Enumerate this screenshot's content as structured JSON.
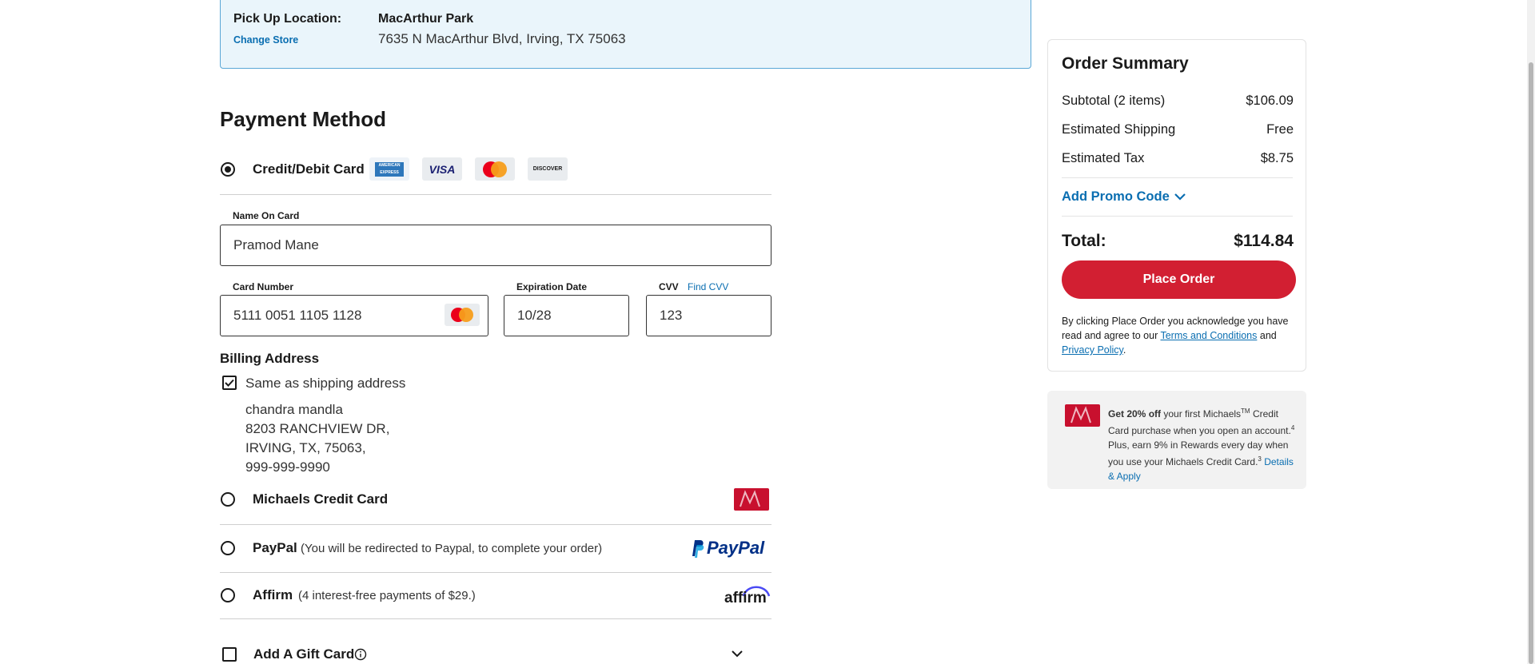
{
  "pickup": {
    "label": "Pick Up Location:",
    "change_link": "Change Store",
    "store_name": "MacArthur Park",
    "store_address": "7635 N MacArthur Blvd, Irving, TX 75063"
  },
  "payment": {
    "title": "Payment Method",
    "credit_option": {
      "label": "Credit/Debit Card",
      "selected": true,
      "card_brands": [
        "AMERICAN EXPRESS",
        "VISA",
        "MasterCard",
        "DISCOVER"
      ]
    },
    "name_field": {
      "label": "Name On Card",
      "value": "Pramod Mane"
    },
    "card_number_field": {
      "label": "Card Number",
      "value": "5111 0051 1105 1128"
    },
    "expiration_field": {
      "label": "Expiration Date",
      "value": "10/28"
    },
    "cvv_field": {
      "label": "CVV",
      "find_link": "Find CVV",
      "value": "123"
    },
    "billing": {
      "title": "Billing Address",
      "same_as_shipping_label": "Same as shipping address",
      "same_as_shipping_checked": true,
      "address_lines": [
        "chandra mandla",
        "8203 RANCHVIEW DR,",
        "IRVING, TX, 75063,",
        "999-999-9990"
      ]
    },
    "michaels_option": {
      "label": "Michaels Credit Card"
    },
    "paypal_option": {
      "label": "PayPal",
      "note": "(You will be redirected to Paypal, to complete your order)",
      "logo": "PayPal"
    },
    "affirm_option": {
      "label": "Affirm",
      "note": "(4 interest-free payments of $29.)",
      "logo": "affirm"
    },
    "gift_card": {
      "label": "Add A Gift Card"
    }
  },
  "summary": {
    "title": "Order Summary",
    "subtotal_label": "Subtotal (2 items)",
    "subtotal_value": "$106.09",
    "shipping_label": "Estimated Shipping",
    "shipping_value": "Free",
    "tax_label": "Estimated Tax",
    "tax_value": "$8.75",
    "promo_label": "Add Promo Code",
    "total_label": "Total:",
    "total_value": "$114.84",
    "place_order": "Place Order",
    "disclaimer_pre": "By clicking Place Order you acknowledge you have read and agree to our ",
    "terms_link": "Terms and Conditions",
    "disclaimer_mid": " and ",
    "privacy_link": "Privacy Policy",
    "disclaimer_end": "."
  },
  "promo": {
    "bold": "Get 20% off",
    "text1": " your first Michaels",
    "tm": "TM",
    "text2": " Credit Card purchase when you open an account.",
    "sup1": "4",
    "text3": " Plus, earn 9% in Rewards every day when you use your Michaels Credit Card.",
    "sup2": "3",
    "link": "Details & Apply"
  },
  "colors": {
    "accent_blue": "#0a6eb1",
    "brand_red": "#d21f32",
    "pickup_bg": "#eaf5fb"
  }
}
